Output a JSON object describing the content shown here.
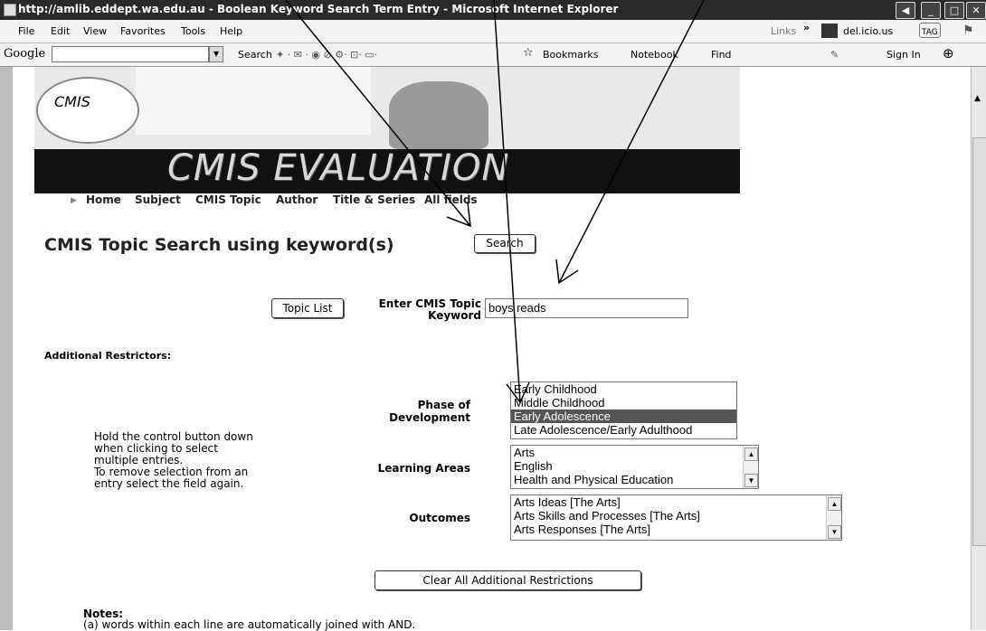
{
  "window": {
    "title": "http://amlib.eddept.wa.edu.au - Boolean Keyword Search Term Entry - Microsoft Internet Explorer"
  },
  "menubar": {
    "items": [
      "File",
      "Edit",
      "View",
      "Favorites",
      "Tools",
      "Help"
    ],
    "links_label": "Links",
    "delicious_label": "del.icio.us",
    "tag_label": "TAG"
  },
  "googlebar": {
    "brand": "Google",
    "search_label": "Search",
    "bookmarks_label": "Bookmarks",
    "notebook_label": "Notebook",
    "find_label": "Find",
    "signin_label": "Sign In"
  },
  "banner": {
    "logo_text": "CMIS",
    "heading": "CMIS EVALUATION"
  },
  "nav": [
    "Home",
    "Subject",
    "CMIS Topic",
    "Author",
    "Title & Series",
    "All fields"
  ],
  "page": {
    "title": "CMIS Topic Search using keyword(s)",
    "search_button": "Search",
    "topic_list_button": "Topic List",
    "keyword_label_line1": "Enter CMIS Topic",
    "keyword_label_line2": "Keyword",
    "keyword_value": "boys reads",
    "additional_restrictors": "Additional Restrictors:",
    "phase_label_line1": "Phase of",
    "phase_label_line2": "Development",
    "phase_options": [
      "Early Childhood",
      "Middle Childhood",
      "Early Adolescence",
      "Late Adolescence/Early Adulthood"
    ],
    "phase_selected_index": 2,
    "learning_label": "Learning Areas",
    "learning_options": [
      "Arts",
      "English",
      "Health and Physical Education"
    ],
    "outcomes_label": "Outcomes",
    "outcomes_options": [
      "Arts Ideas [The Arts]",
      "Arts Skills and Processes [The Arts]",
      "Arts Responses [The Arts]"
    ],
    "help_lines": [
      "Hold the control button down",
      "when clicking to select",
      "multiple entries.",
      "To remove selection from an",
      "entry select the field again."
    ],
    "clear_button": "Clear All Additional Restrictions",
    "notes_heading": "Notes:",
    "notes_line_a": "(a) words within each line are automatically joined with AND."
  }
}
